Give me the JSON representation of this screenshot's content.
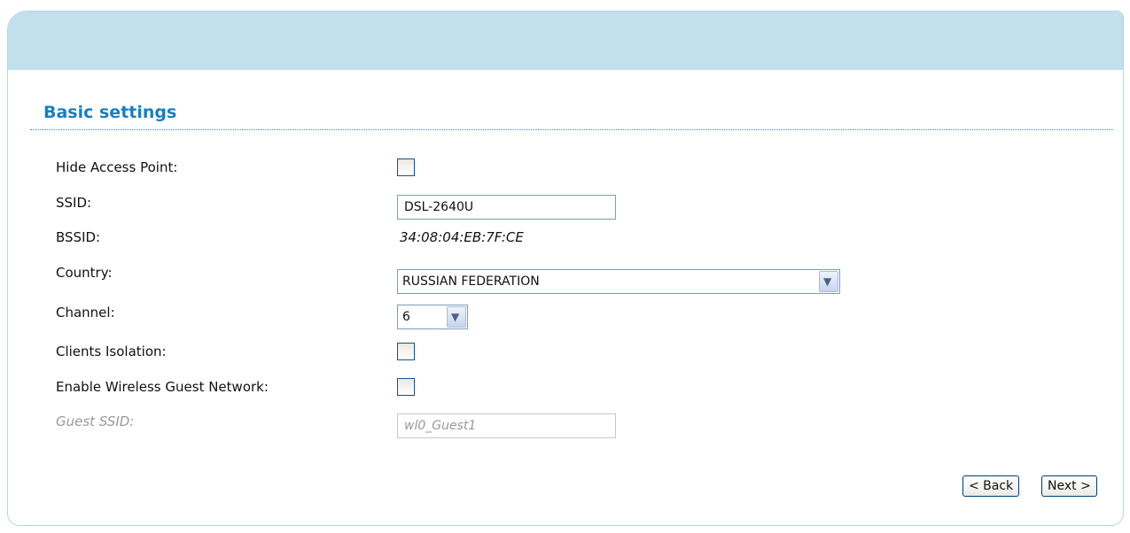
{
  "section": {
    "title": "Basic settings"
  },
  "fields": {
    "hide_ap": {
      "label": "Hide Access Point:",
      "checked": false
    },
    "ssid": {
      "label": "SSID:",
      "value": "DSL-2640U"
    },
    "bssid": {
      "label": "BSSID:",
      "value": "34:08:04:EB:7F:CE"
    },
    "country": {
      "label": "Country:",
      "value": "RUSSIAN FEDERATION"
    },
    "channel": {
      "label": "Channel:",
      "value": "6"
    },
    "clients_isolation": {
      "label": "Clients Isolation:",
      "checked": false
    },
    "guest_network": {
      "label": "Enable Wireless Guest Network:",
      "checked": false
    },
    "guest_ssid": {
      "label": "Guest SSID:",
      "placeholder": "wl0_Guest1"
    }
  },
  "buttons": {
    "back": "< Back",
    "next": "Next >"
  },
  "icons": {
    "dropdown": "chevron-down-icon"
  },
  "colors": {
    "header": "#c2dfee",
    "title": "#1a7fbd",
    "divider": "#3b8fc2"
  }
}
